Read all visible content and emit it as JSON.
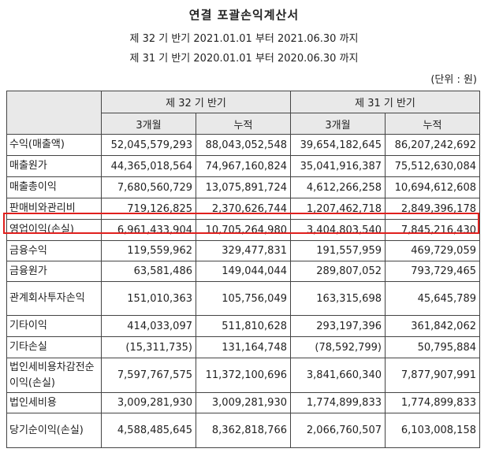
{
  "title": "연결 포괄손익계산서",
  "period_current": "제 32 기 반기 2021.01.01 부터 2021.06.30 까지",
  "period_prior": "제 31 기 반기 2020.01.01 부터 2020.06.30 까지",
  "unit": "(단위 : 원)",
  "headers": {
    "current": "제 32 기 반기",
    "prior": "제 31 기 반기",
    "three_month": "3개월",
    "cumulative": "누적"
  },
  "rows": [
    {
      "label": "수익(매출액)",
      "v": [
        "52,045,579,293",
        "88,043,052,548",
        "39,654,182,645",
        "86,207,242,692"
      ]
    },
    {
      "label": "매출원가",
      "v": [
        "44,365,018,564",
        "74,967,160,824",
        "35,041,916,387",
        "75,512,630,084"
      ]
    },
    {
      "label": "매출총이익",
      "v": [
        "7,680,560,729",
        "13,075,891,724",
        "4,612,266,258",
        "10,694,612,608"
      ]
    },
    {
      "label": "판매비와관리비",
      "v": [
        "719,126,825",
        "2,370,626,744",
        "1,207,462,718",
        "2,849,396,178"
      ]
    },
    {
      "label": "영업이익(손실)",
      "v": [
        "6,961,433,904",
        "10,705,264,980",
        "3,404,803,540",
        "7,845,216,430"
      ]
    },
    {
      "label": "금융수익",
      "v": [
        "119,559,962",
        "329,477,831",
        "191,557,959",
        "469,729,059"
      ]
    },
    {
      "label": "금융원가",
      "v": [
        "63,581,486",
        "149,044,044",
        "289,807,052",
        "793,729,465"
      ]
    },
    {
      "label": "관계회사투자손익",
      "v": [
        "151,010,363",
        "105,756,049",
        "163,315,698",
        "45,645,789"
      ]
    },
    {
      "label": "기타이익",
      "v": [
        "414,033,097",
        "511,810,628",
        "293,197,396",
        "361,842,062"
      ]
    },
    {
      "label": "기타손실",
      "v": [
        "(15,311,735)",
        "131,164,748",
        "(78,592,799)",
        "50,795,884"
      ]
    },
    {
      "label": "법인세비용차감전순이익(손실)",
      "v": [
        "7,597,767,575",
        "11,372,100,696",
        "3,841,660,340",
        "7,877,907,991"
      ]
    },
    {
      "label": "법인세비용",
      "v": [
        "3,009,281,930",
        "3,009,281,930",
        "1,774,899,833",
        "1,774,899,833"
      ]
    },
    {
      "label": "당기순이익(손실)",
      "v": [
        "4,588,485,645",
        "8,362,818,766",
        "2,066,760,507",
        "6,103,008,158"
      ]
    }
  ]
}
